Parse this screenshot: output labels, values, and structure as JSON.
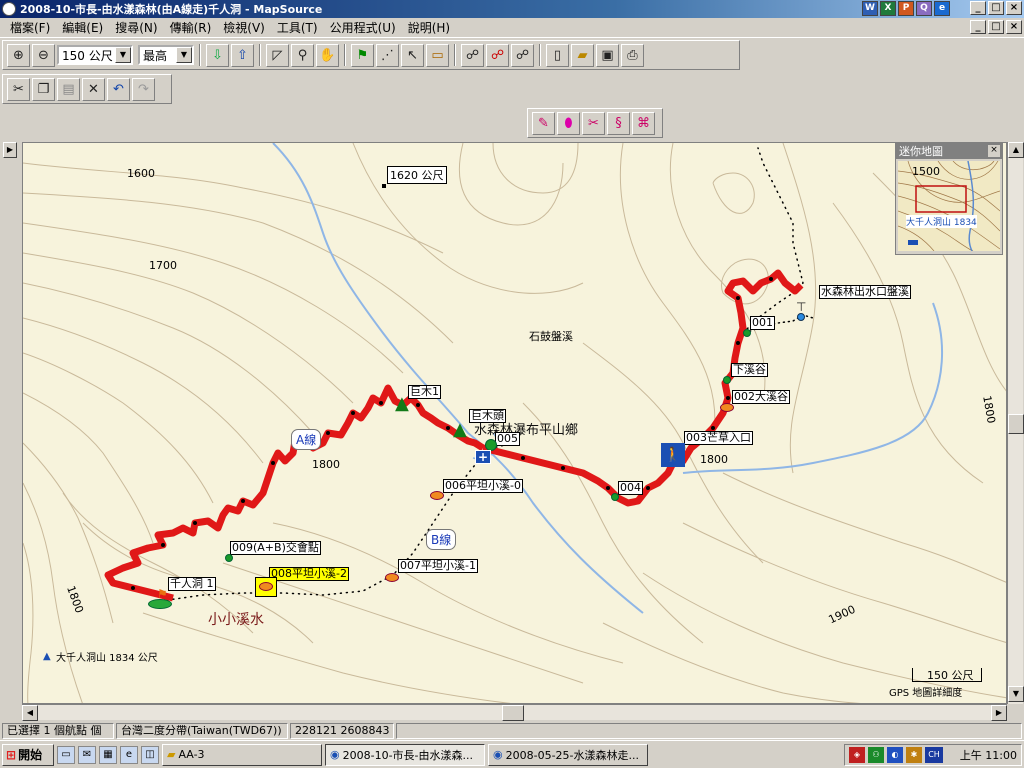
{
  "window": {
    "title": "2008-10-市長-由水漾森林(由A線走)千人洞 - MapSource",
    "btn_min": "_",
    "btn_max": "□",
    "btn_close": "×",
    "min2": "_",
    "max2": "□",
    "close2": "×"
  },
  "office_icons": [
    "W",
    "X",
    "P",
    "Q",
    "e"
  ],
  "menu": [
    "檔案(F)",
    "編輯(E)",
    "搜尋(N)",
    "傳輸(R)",
    "檢視(V)",
    "工具(T)",
    "公用程式(U)",
    "說明(H)"
  ],
  "toolbar": {
    "zoom_value": "150 公尺",
    "detail_value": "最高"
  },
  "map": {
    "contours": [
      "1600",
      "1700",
      "1800",
      "1800",
      "1800",
      "1900",
      "1800"
    ],
    "spot": "1620 公尺",
    "river": "石鼓盤溪",
    "waypoints": {
      "w1": "水森林出水口盤溪",
      "w2": "001",
      "w3": "下溪谷",
      "w4": "002大溪谷",
      "w5": "003芒草入口",
      "w6": "004",
      "w7": "巨木1",
      "w8": "巨木頭",
      "w9": "005",
      "w10": "006平坦小溪-0",
      "w11": "007平坦小溪-1",
      "w12": "008平坦小溪-2",
      "w13": "009(A+B)交會點",
      "w14": "千人洞 1"
    },
    "overlap_text": "水森林瀑布平山鄉",
    "route_a": "A線",
    "route_b": "B線",
    "stream_note": "小小溪水",
    "peak": "大千人洞山 1834 公尺",
    "scale": "150 公尺",
    "detail": "GPS 地圖詳細度"
  },
  "minimap": {
    "title": "迷你地圖",
    "contour": "1500",
    "peak": "大千人洞山 1834"
  },
  "status": {
    "selection": "已選擇 1 個航點 個",
    "datum": "台灣二度分帶(Taiwan(TWD67))",
    "coords": "228121 2608843"
  },
  "taskbar": {
    "start": "開始",
    "tasks": [
      "AA-3",
      "2008-10-市長-由水漾森...",
      "2008-05-25-水漾森林走..."
    ],
    "clock": "上午 11:00",
    "tray_ch": "CH"
  },
  "colors": {
    "map_bg": "#f7f3dc",
    "contour": "#c9b99a",
    "river": "#8fb6e6",
    "route_a": "#e01818",
    "route_b": "#111111"
  }
}
